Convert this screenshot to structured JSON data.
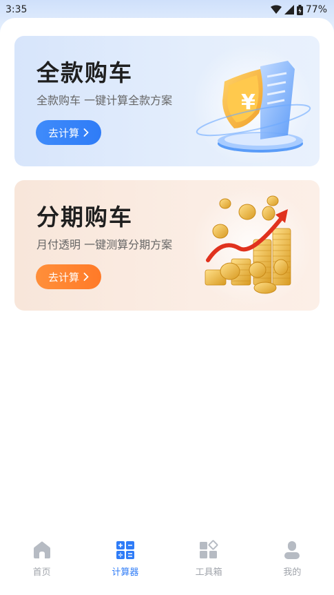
{
  "status": {
    "time": "3:35",
    "battery": "77%"
  },
  "cards": [
    {
      "title": "全款购车",
      "subtitle": "全款购车 一键计算全款方案",
      "button": "去计算"
    },
    {
      "title": "分期购车",
      "subtitle": "月付透明 一键测算分期方案",
      "button": "去计算"
    }
  ],
  "tabs": [
    {
      "label": "首页",
      "icon": "home-icon"
    },
    {
      "label": "计算器",
      "icon": "calculator-icon"
    },
    {
      "label": "工具箱",
      "icon": "toolbox-icon"
    },
    {
      "label": "我的",
      "icon": "profile-icon"
    }
  ],
  "colors": {
    "accent": "#2f7cf7",
    "orange": "#ff7a28",
    "inactive": "#a0a4ab"
  }
}
